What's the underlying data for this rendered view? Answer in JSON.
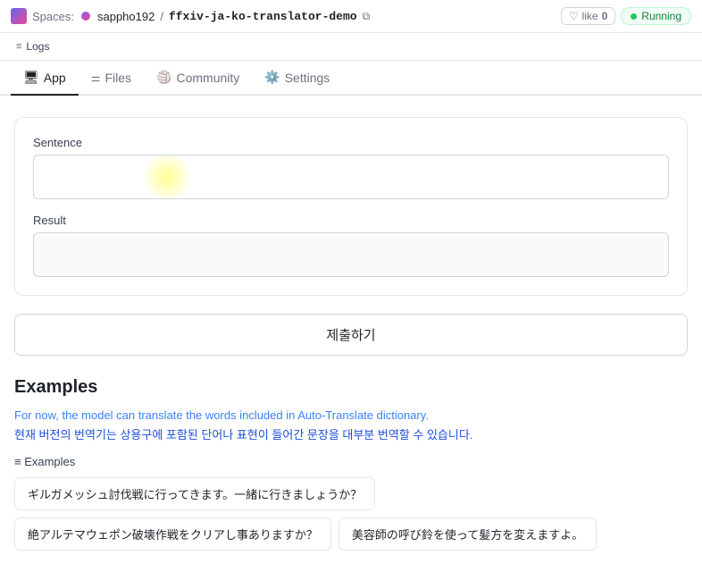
{
  "header": {
    "spaces_label": "Spaces:",
    "username": "sappho192",
    "separator": "/",
    "repo_name": "ffxiv-ja-ko-translator-demo",
    "like_label": "like",
    "like_count": "0",
    "status_label": "Running"
  },
  "logs_bar": {
    "logs_label": "Logs"
  },
  "tabs": [
    {
      "id": "app",
      "label": "App",
      "icon": "🖥",
      "active": true
    },
    {
      "id": "files",
      "label": "Files",
      "icon": "📄",
      "active": false
    },
    {
      "id": "community",
      "label": "Community",
      "icon": "🏐",
      "active": false
    },
    {
      "id": "settings",
      "label": "Settings",
      "icon": "⚙️",
      "active": false
    }
  ],
  "form": {
    "sentence_label": "Sentence",
    "sentence_placeholder": "",
    "result_label": "Result",
    "result_placeholder": "",
    "submit_label": "제출하기"
  },
  "examples": {
    "title": "Examples",
    "desc_en": "For now, the model can translate the words included in Auto-Translate dictionary.",
    "desc_ko": "현재 버전의 번역기는 상용구에 포함된 단어나 표현이 들어간 문장을 대부분 번역할 수 있습니다.",
    "section_header": "≡ Examples",
    "rows": [
      [
        {
          "text": "ギルガメッシュ討伐戦に行ってきます。一緒に行きましょうか？"
        }
      ],
      [
        {
          "text": "絶アルテマウェポン破壊作戦をクリアし事ありますか？"
        },
        {
          "text": "美容師の呼び鈴を使って髪方を変えますよ。"
        }
      ]
    ]
  }
}
